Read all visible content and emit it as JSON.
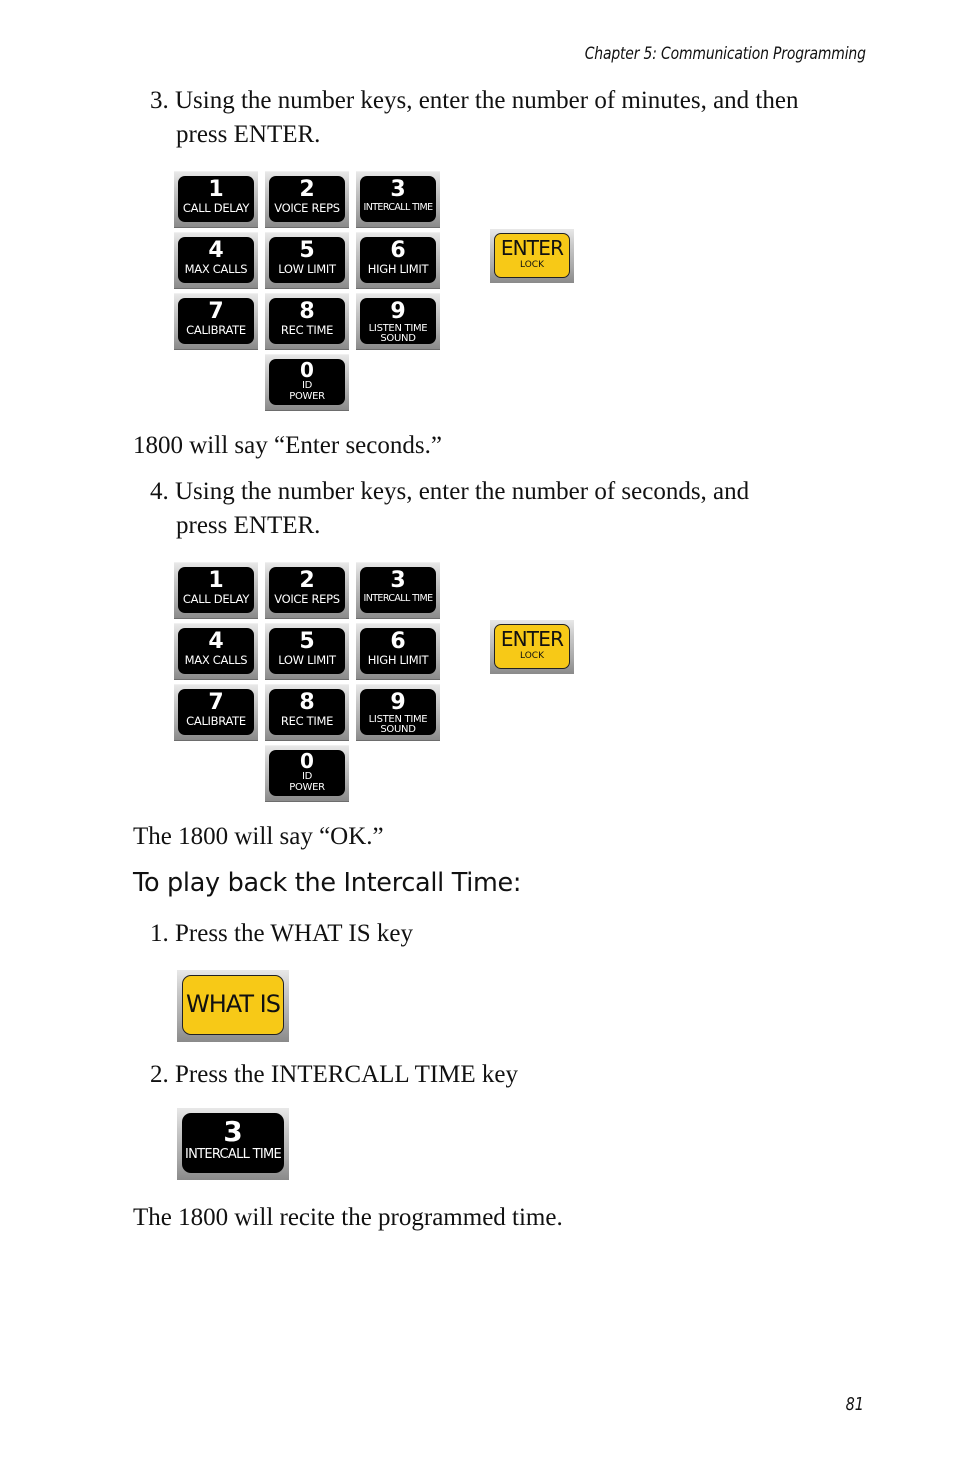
{
  "header": {
    "chapter": "Chapter 5: Communication Programming"
  },
  "page_number": "81",
  "steps": {
    "step3_line1": "3. Using the number keys, enter the number of minutes, and then",
    "step3_line2": "press ENTER.",
    "say_enter_seconds": "1800 will say “Enter seconds.”",
    "step4_line1": "4. Using the number keys, enter the number of seconds, and",
    "step4_line2": "press ENTER.",
    "say_ok": "The 1800 will say “OK.”"
  },
  "playback": {
    "heading": "To play back the Intercall Time:",
    "step1": "1. Press the WHAT IS key",
    "step2": "2. Press the INTERCALL TIME key",
    "result": "The 1800 will recite the programmed time."
  },
  "keypad": {
    "keys": [
      {
        "num": "1",
        "label": "CALL DELAY"
      },
      {
        "num": "2",
        "label": "VOICE REPS"
      },
      {
        "num": "3",
        "label": "INTERCALL TIME"
      },
      {
        "num": "4",
        "label": "MAX CALLS"
      },
      {
        "num": "5",
        "label": "LOW LIMIT"
      },
      {
        "num": "6",
        "label": "HIGH LIMIT"
      },
      {
        "num": "7",
        "label": "CALIBRATE"
      },
      {
        "num": "8",
        "label": "REC TIME"
      },
      {
        "num": "9",
        "label": "LISTEN TIME",
        "label2": "SOUND"
      },
      {
        "num": "0",
        "label": "ID",
        "label2": "POWER"
      }
    ],
    "enter": {
      "label": "ENTER",
      "sublabel": "LOCK"
    }
  },
  "what_is_key": {
    "label": "WHAT IS"
  },
  "intercall_key": {
    "num": "3",
    "label": "INTERCALL TIME"
  },
  "colors": {
    "key_yellow": "#f7c917",
    "key_black": "#000000"
  }
}
